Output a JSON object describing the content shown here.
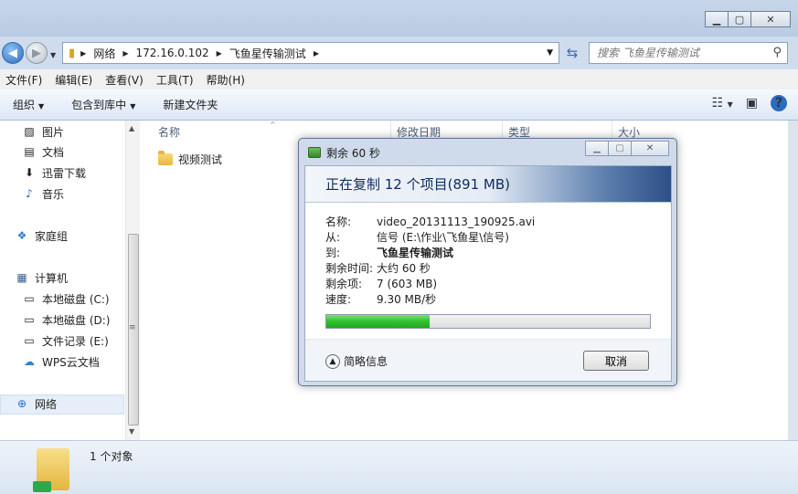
{
  "window": {
    "buttons": [
      "▁",
      "▢",
      "✕"
    ]
  },
  "address": {
    "crumbs": [
      "网络",
      "172.16.0.102",
      "飞鱼星传输测试"
    ],
    "search_placeholder": "搜索 飞鱼星传输测试"
  },
  "menubar": [
    "文件(F)",
    "编辑(E)",
    "查看(V)",
    "工具(T)",
    "帮助(H)"
  ],
  "toolbar": {
    "organize": "组织",
    "include_library": "包含到库中",
    "new_folder": "新建文件夹"
  },
  "navpane": {
    "items": [
      {
        "label": "图片",
        "icon": "pictures-icon"
      },
      {
        "label": "文档",
        "icon": "documents-icon"
      },
      {
        "label": "迅雷下载",
        "icon": "download-folder-icon"
      },
      {
        "label": "音乐",
        "icon": "music-icon"
      },
      {
        "label": "家庭组",
        "icon": "homegroup-icon"
      },
      {
        "label": "计算机",
        "icon": "computer-icon"
      },
      {
        "label": "本地磁盘 (C:)",
        "icon": "drive-c-icon"
      },
      {
        "label": "本地磁盘 (D:)",
        "icon": "drive-icon"
      },
      {
        "label": "文件记录 (E:)",
        "icon": "drive-icon"
      },
      {
        "label": "WPS云文档",
        "icon": "cloud-icon"
      },
      {
        "label": "网络",
        "icon": "network-icon"
      }
    ]
  },
  "filepane": {
    "columns": [
      "名称",
      "修改日期",
      "类型",
      "大小"
    ],
    "files": [
      {
        "name": "视频测试"
      }
    ]
  },
  "details": {
    "count": "1 个对象"
  },
  "dialog": {
    "title": "剩余 60 秒",
    "banner": "正在复制 12 个项目(891 MB)",
    "rows": [
      {
        "label": "名称:",
        "value": "video_20131113_190925.avi"
      },
      {
        "label": "从:",
        "value": "信号 (E:\\作业\\飞鱼星\\信号)"
      },
      {
        "label": "到:",
        "value": "飞鱼星传输测试"
      },
      {
        "label": "剩余时间:",
        "value": "大约 60 秒"
      },
      {
        "label": "剩余项:",
        "value": "7 (603 MB)"
      },
      {
        "label": "速度:",
        "value": "9.30 MB/秒"
      }
    ],
    "progress": 0.32,
    "less_info": "简略信息",
    "cancel": "取消"
  }
}
